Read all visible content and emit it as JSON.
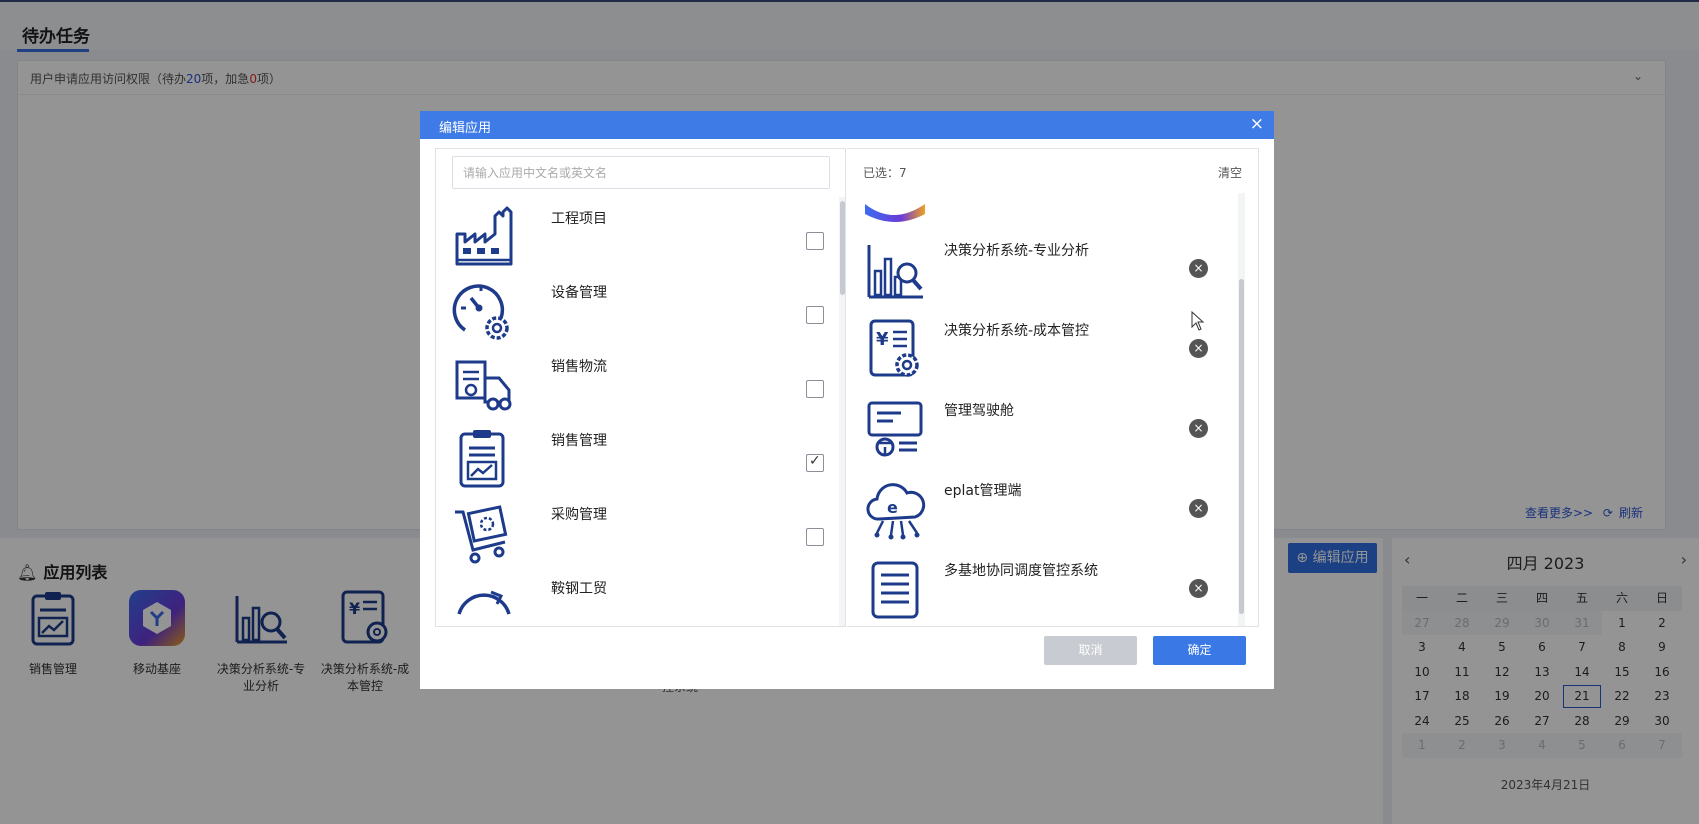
{
  "page": {
    "tasks_title": "待办任务",
    "task_row": {
      "prefix": "用户申请应用访问权限（待办",
      "pending_count": "20",
      "middle": "项，加急",
      "urgent_count": "0",
      "suffix": "项）"
    },
    "view_more": "查看更多>>",
    "refresh": "刷新",
    "apps_title": "应用列表",
    "edit_apps_button": "编辑应用",
    "app_tiles": [
      {
        "label": "销售管理",
        "icon": "sales-chart-icon"
      },
      {
        "label": "移动基座",
        "icon": "mobile-base-icon"
      },
      {
        "label": "决策分析系统-专业分析",
        "icon": "analysis-chart-icon"
      },
      {
        "label": "决策分析系统-成本管控",
        "icon": "cost-control-icon"
      }
    ],
    "stray_text": "控系统"
  },
  "calendar": {
    "title": "四月 2023",
    "weekdays": [
      "一",
      "二",
      "三",
      "四",
      "五",
      "六",
      "日"
    ],
    "weeks": [
      [
        "27",
        "28",
        "29",
        "30",
        "31",
        "1",
        "2"
      ],
      [
        "3",
        "4",
        "5",
        "6",
        "7",
        "8",
        "9"
      ],
      [
        "10",
        "11",
        "12",
        "13",
        "14",
        "15",
        "16"
      ],
      [
        "17",
        "18",
        "19",
        "20",
        "21",
        "22",
        "23"
      ],
      [
        "24",
        "25",
        "26",
        "27",
        "28",
        "29",
        "30"
      ],
      [
        "1",
        "2",
        "3",
        "4",
        "5",
        "6",
        "7"
      ]
    ],
    "today": "21",
    "footer": "2023年4月21日"
  },
  "modal": {
    "title": "编辑应用",
    "search_placeholder": "请输入应用中文名或英文名",
    "apps": [
      {
        "label": "工程项目",
        "checked": false,
        "icon": "factory-icon"
      },
      {
        "label": "设备管理",
        "checked": false,
        "icon": "gauge-gear-icon"
      },
      {
        "label": "销售物流",
        "checked": false,
        "icon": "delivery-truck-icon"
      },
      {
        "label": "销售管理",
        "checked": true,
        "icon": "sales-chart-icon"
      },
      {
        "label": "采购管理",
        "checked": false,
        "icon": "purchase-cart-icon"
      },
      {
        "label": "鞍钢工贸",
        "checked": false,
        "icon": "trade-icon"
      }
    ],
    "selected_label": "已选：7",
    "clear_label": "清空",
    "selected": [
      {
        "label": "决策分析系统-专业分析",
        "icon": "analysis-chart-icon"
      },
      {
        "label": "决策分析系统-成本管控",
        "icon": "cost-control-icon"
      },
      {
        "label": "管理驾驶舱",
        "icon": "cockpit-icon"
      },
      {
        "label": "eplat管理端",
        "icon": "cloud-e-icon"
      },
      {
        "label": "多基地协同调度管控系统",
        "icon": "list-doc-icon"
      }
    ],
    "cancel_label": "取消",
    "ok_label": "确定"
  },
  "colors": {
    "accent": "#3f7be6",
    "icon_navy": "#1d3b8a",
    "urgent_red": "#e0302a"
  }
}
